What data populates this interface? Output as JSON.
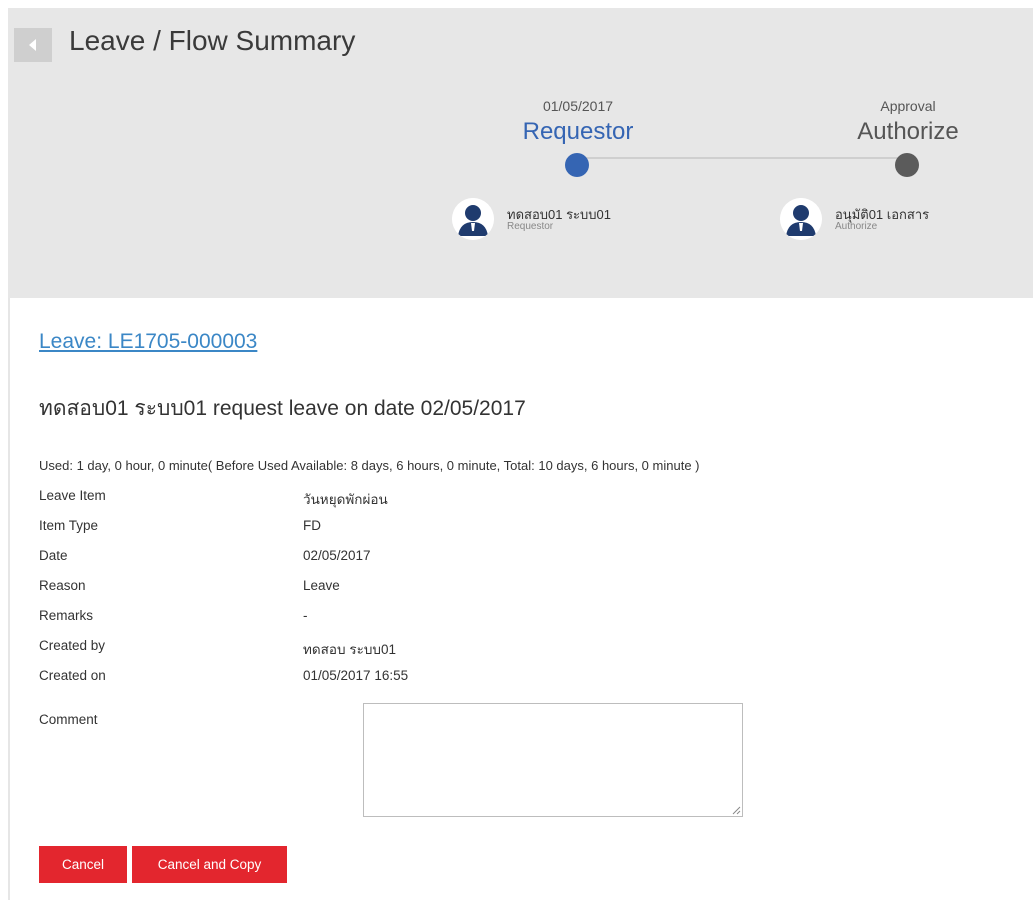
{
  "header": {
    "title": "Leave / Flow Summary",
    "back_icon": "chevron-left-icon"
  },
  "flow": {
    "steps": [
      {
        "top": "01/05/2017",
        "name": "Requestor",
        "color": "#3565b3",
        "active": true
      },
      {
        "top": "Approval",
        "name": "Authorize",
        "color": "#5b5b5b",
        "active": false
      }
    ],
    "people": [
      {
        "name": "ทดสอบ01 ระบบ01",
        "role": "Requestor",
        "icon": "user-avatar-icon"
      },
      {
        "name": "อนุมัติ01 เอกสาร",
        "role": "Authorize",
        "icon": "user-avatar-icon"
      }
    ]
  },
  "document": {
    "link": "Leave: LE1705-000003",
    "headline": "ทดสอบ01 ระบบ01 request leave on date 02/05/2017",
    "used": "Used: 1 day, 0 hour, 0 minute( Before Used Available: 8 days, 6 hours, 0 minute, Total: 10 days, 6 hours, 0 minute )",
    "details": [
      {
        "label": "Leave Item",
        "value": "วันหยุดพักผ่อน"
      },
      {
        "label": "Item Type",
        "value": "FD"
      },
      {
        "label": "Date",
        "value": "02/05/2017"
      },
      {
        "label": "Reason",
        "value": "Leave"
      },
      {
        "label": "Remarks",
        "value": "-"
      },
      {
        "label": "Created by",
        "value": "ทดสอบ ระบบ01"
      },
      {
        "label": "Created on",
        "value": "01/05/2017 16:55"
      }
    ],
    "comment_label": "Comment",
    "comment_value": ""
  },
  "actions": {
    "cancel": "Cancel",
    "cancel_copy": "Cancel and Copy",
    "button_color": "#e3262e",
    "link_color": "#3b87c6"
  }
}
